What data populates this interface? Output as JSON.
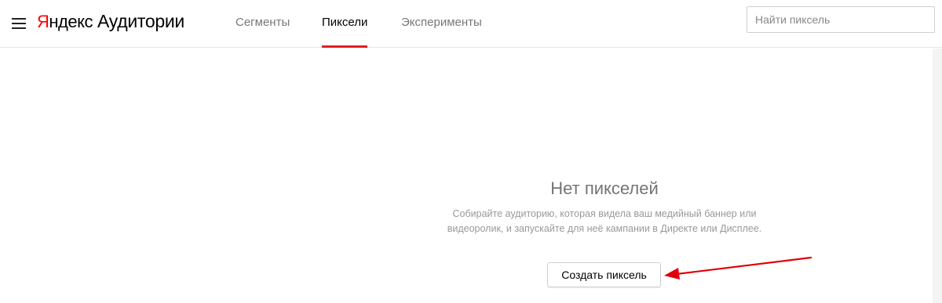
{
  "header": {
    "menu_icon": "hamburger-menu-icon",
    "logo": {
      "brand_first_letter": "Я",
      "brand_rest": "ндекс",
      "service": "Аудитории",
      "brand_color": "#ff0000"
    },
    "tabs": [
      {
        "label": "Сегменты",
        "active": false
      },
      {
        "label": "Пиксели",
        "active": true
      },
      {
        "label": "Эксперименты",
        "active": false
      }
    ],
    "active_tab_color": "#e31e24",
    "search": {
      "placeholder": "Найти пиксель",
      "value": ""
    }
  },
  "empty_state": {
    "title": "Нет пикселей",
    "description": "Собирайте аудиторию, которая видела ваш медийный баннер или видеоролик, и запускайте для неё кампании в Директе или Дисплее.",
    "create_button_label": "Создать пиксель"
  },
  "annotation": {
    "arrow_color": "#e0000b",
    "arrow_icon": "red-arrow-pointer"
  }
}
